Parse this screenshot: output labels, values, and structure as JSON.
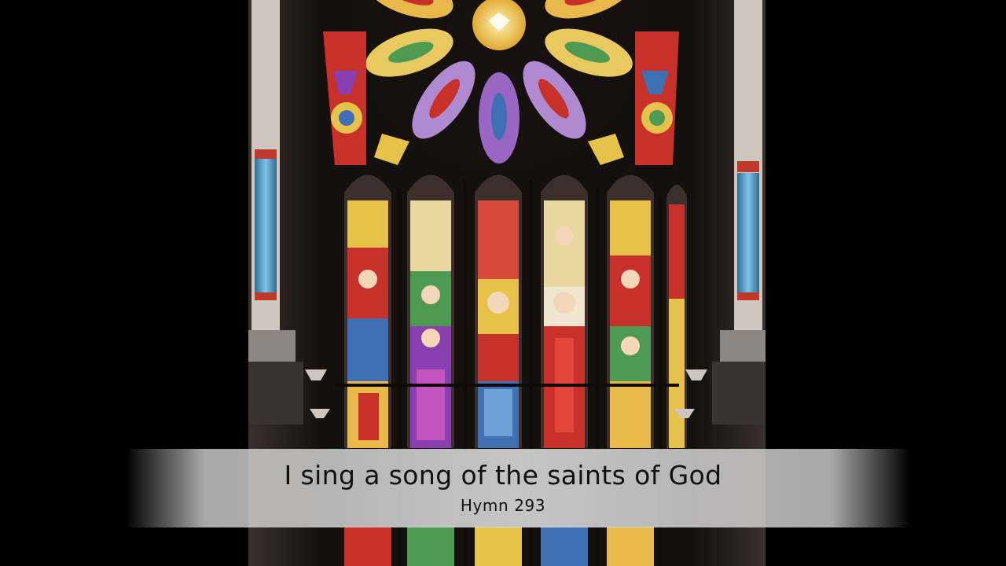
{
  "video": {
    "title": "I sing a song of the saints of God",
    "subtitle": "Hymn 293"
  },
  "image": {
    "subject": "stained-glass-window",
    "colors": {
      "background": "#000000",
      "stone": "#2a2220",
      "lead": "#14100e",
      "glass_gold": "#e8c34a",
      "glass_red": "#c8302a",
      "glass_blue": "#3f6fb5",
      "glass_purple": "#8a3fb0",
      "glass_green": "#4f9a52",
      "pillar_blue": "#5aa7d0"
    }
  }
}
